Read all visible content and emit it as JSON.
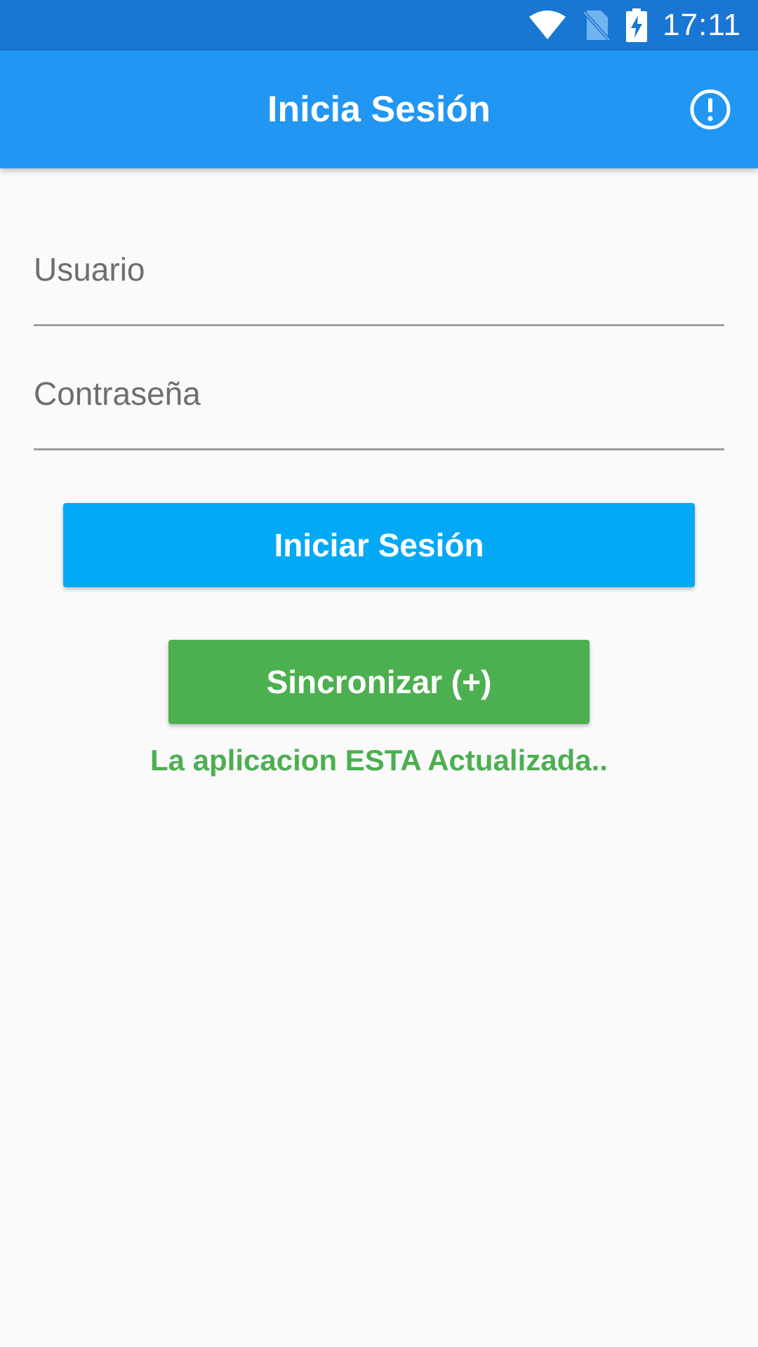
{
  "status_bar": {
    "time": "17:11",
    "icons": [
      "wifi-icon",
      "no-sim-icon",
      "battery-charging-icon"
    ],
    "color": "#1976D2"
  },
  "app_bar": {
    "title": "Inicia Sesión",
    "color": "#2196F3",
    "action_icon": "info-outline-icon"
  },
  "form": {
    "user_placeholder": "Usuario",
    "user_value": "",
    "password_placeholder": "Contraseña",
    "password_value": ""
  },
  "buttons": {
    "login_label": "Iniciar Sesión",
    "login_color": "#03A9F4",
    "sync_label": "Sincronizar (+)",
    "sync_color": "#4CAF50"
  },
  "status_message": {
    "text": "La aplicacion ESTA Actualizada..",
    "color": "#4CAF50"
  }
}
